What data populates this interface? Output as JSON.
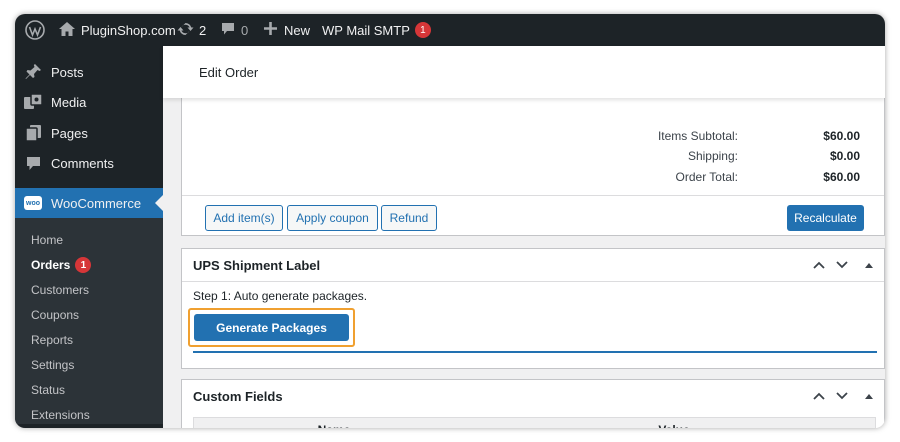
{
  "adminbar": {
    "site_name": "PluginShop.com",
    "updates_count": "2",
    "comments_count": "0",
    "new_label": "New",
    "smtp_label": "WP Mail SMTP",
    "smtp_badge": "1"
  },
  "sidebar": {
    "items": [
      {
        "label": "Posts",
        "icon": "pin-icon"
      },
      {
        "label": "Media",
        "icon": "media-icon"
      },
      {
        "label": "Pages",
        "icon": "pages-icon"
      },
      {
        "label": "Comments",
        "icon": "comment-icon"
      }
    ],
    "woocommerce_label": "WooCommerce",
    "woo_icon_text": "woo",
    "submenu": [
      "Home",
      "Orders",
      "Customers",
      "Coupons",
      "Reports",
      "Settings",
      "Status",
      "Extensions"
    ],
    "orders_badge": "1"
  },
  "header": {
    "title": "Edit Order"
  },
  "totals": {
    "subtotal_label": "Items Subtotal:",
    "subtotal_value": "$60.00",
    "shipping_label": "Shipping:",
    "shipping_value": "$0.00",
    "total_label": "Order Total:",
    "total_value": "$60.00"
  },
  "actions": {
    "add_items": "Add item(s)",
    "apply_coupon": "Apply coupon",
    "refund": "Refund",
    "recalculate": "Recalculate"
  },
  "ups_panel": {
    "title": "UPS Shipment Label",
    "step_text": "Step 1: Auto generate packages.",
    "generate_button": "Generate Packages"
  },
  "custom_fields": {
    "title": "Custom Fields",
    "columns": [
      "Name",
      "Value"
    ]
  },
  "colors": {
    "wp_blue": "#2271b1",
    "admin_dark": "#1d2327",
    "badge_red": "#d63638",
    "highlight_orange": "#f0a030"
  }
}
